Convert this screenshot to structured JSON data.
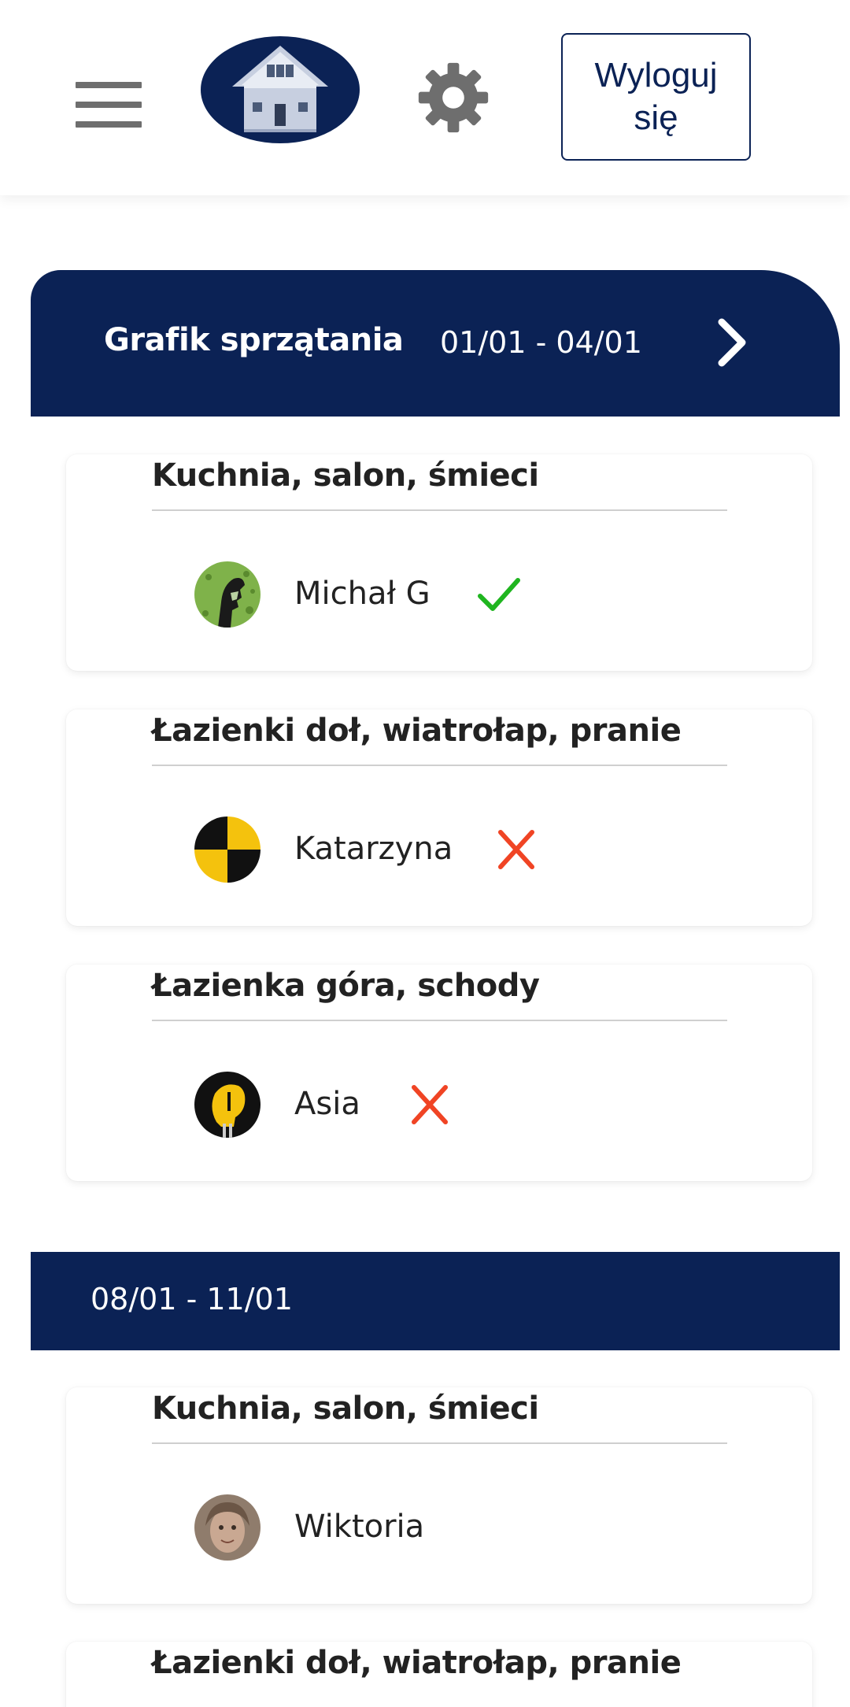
{
  "header": {
    "logout_label": "Wyloguj się",
    "menu_icon": "hamburger-menu-icon",
    "settings_icon": "gear-icon",
    "logo_icon": "house-logo"
  },
  "colors": {
    "navy": "#0b2255",
    "check_green": "#1fb51f",
    "cross_red": "#f04424",
    "gray_icon": "#6e6e6e"
  },
  "weeks": [
    {
      "title": "Grafik sprzątania",
      "dates": "01/01 - 04/01",
      "next_icon": "chevron-right-icon",
      "tasks": [
        {
          "title": "Kuchnia, salon, śmieci",
          "person": "Michał G",
          "status": "done"
        },
        {
          "title": "Łazienki doł, wiatrołap, pranie",
          "person": "Katarzyna",
          "status": "not-done"
        },
        {
          "title": "Łazienka góra, schody",
          "person": "Asia",
          "status": "not-done"
        }
      ]
    },
    {
      "dates": "08/01 - 11/01",
      "tasks": [
        {
          "title": "Kuchnia, salon, śmieci",
          "person": "Wiktoria",
          "status": ""
        },
        {
          "title": "Łazienki doł, wiatrołap, pranie"
        }
      ]
    }
  ]
}
